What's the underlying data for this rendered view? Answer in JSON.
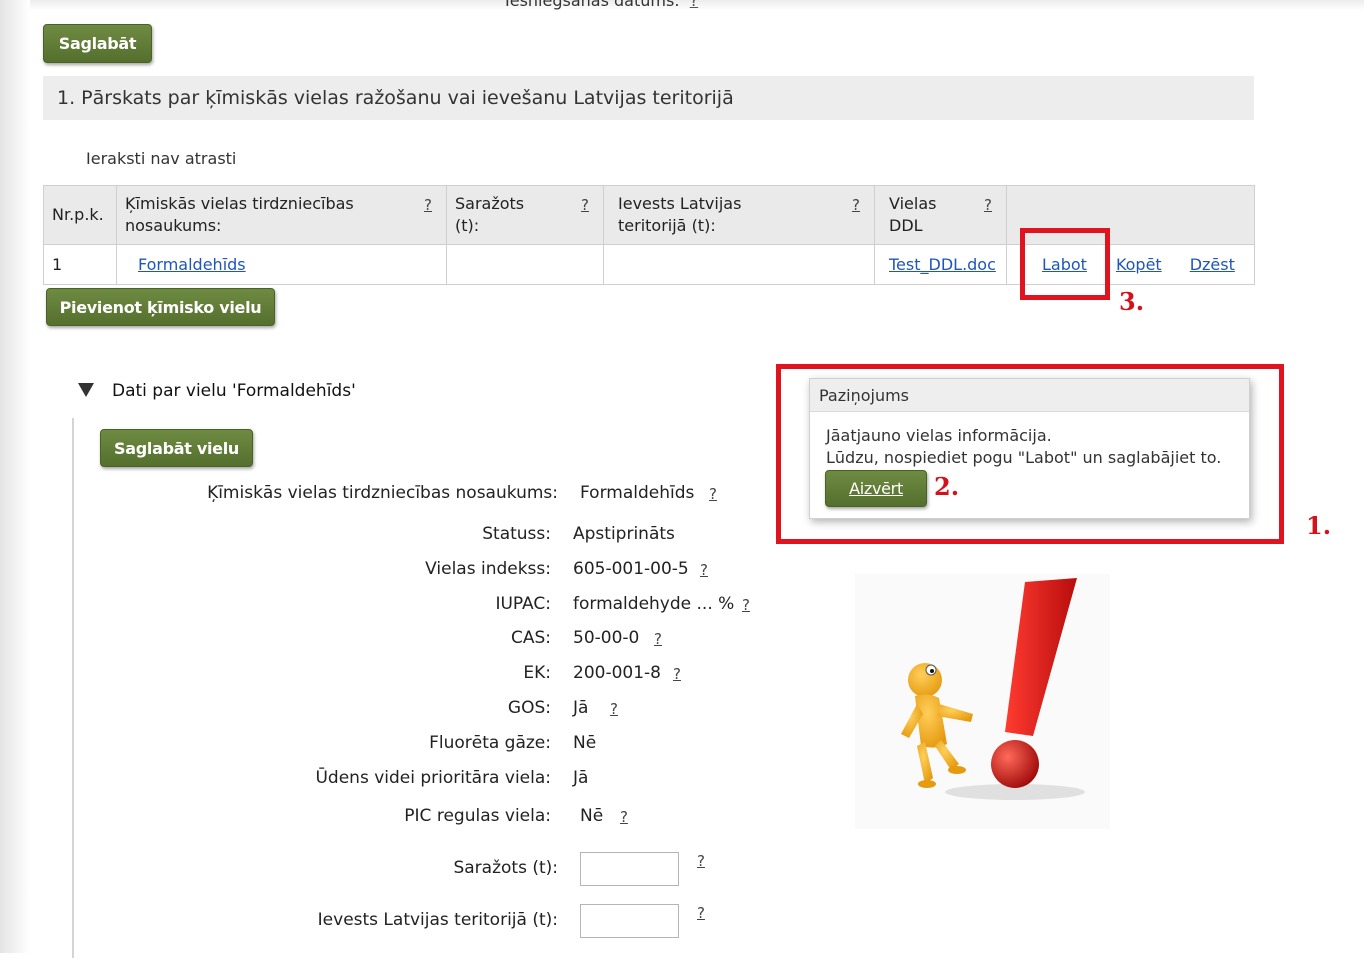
{
  "top": {
    "cut_text": "Iesniegšanas datums:",
    "cut_help": "?",
    "save_button": "Saglabāt"
  },
  "section": {
    "title": "1. Pārskats par ķīmiskās vielas ražošanu vai ievešanu Latvijas teritorijā",
    "no_records": "Ieraksti nav atrasti"
  },
  "table": {
    "headers": [
      {
        "label": "Nr.p.k.",
        "help": ""
      },
      {
        "label": "Ķīmiskās vielas tirdzniecības nosaukums:",
        "help": "?"
      },
      {
        "label": "Saražots (t):",
        "help": "?"
      },
      {
        "label": "Ievests Latvijas teritorijā (t):",
        "help": "?"
      },
      {
        "label": "Vielas DDL",
        "help": "?"
      },
      {
        "label": "",
        "help": ""
      }
    ],
    "rows": [
      {
        "nr": "1",
        "name": "Formaldehīds",
        "produced": "",
        "imported": "",
        "ddl": "Test_DDL.doc",
        "actions": {
          "edit": "Labot",
          "copy": "Kopēt",
          "delete": "Dzēst"
        }
      }
    ]
  },
  "add_button": "Pievienot ķīmisko vielu",
  "annotations": {
    "one": "1.",
    "two": "2.",
    "three": "3."
  },
  "substance": {
    "heading": "Dati par vielu 'Formaldehīds'",
    "save_button": "Saglabāt vielu",
    "fields": [
      {
        "label": "Ķīmiskās vielas tirdzniecības nosaukums:",
        "value": "Formaldehīds",
        "help": "?"
      },
      {
        "label": "Statuss:",
        "value": "Apstiprināts",
        "help": ""
      },
      {
        "label": "Vielas indekss:",
        "value": "605-001-00-5",
        "help": "?"
      },
      {
        "label": "IUPAC:",
        "value": "formaldehyde ... %",
        "help": "?"
      },
      {
        "label": "CAS:",
        "value": "50-00-0",
        "help": "?"
      },
      {
        "label": "EK:",
        "value": "200-001-8",
        "help": "?"
      },
      {
        "label": "GOS:",
        "value": "Jā",
        "help": "?"
      },
      {
        "label": "Fluorēta gāze:",
        "value": "Nē",
        "help": ""
      },
      {
        "label": "Ūdens videi prioritāra viela:",
        "value": "Jā",
        "help": ""
      },
      {
        "label": "PIC regulas viela:",
        "value": "Nē",
        "help": "?"
      }
    ],
    "inputs": [
      {
        "label": "Saražots (t):",
        "value": "",
        "help": "?"
      },
      {
        "label": "Ievests Latvijas teritorijā (t):",
        "value": "",
        "help": "?"
      }
    ]
  },
  "dialog": {
    "title": "Paziņojums",
    "line1": "Jāatjauno vielas informācija.",
    "line2": "Lūdzu, nospiediet pogu \"Labot\" un saglabājiet to.",
    "close_button": "Aizvērt"
  },
  "colors": {
    "button_green": "#5f7c35",
    "annotation_red": "#e0141e",
    "link_blue": "#1f56b8",
    "header_gray": "#ededed"
  },
  "illustration": {
    "icon": "exclamation-figure-icon"
  }
}
